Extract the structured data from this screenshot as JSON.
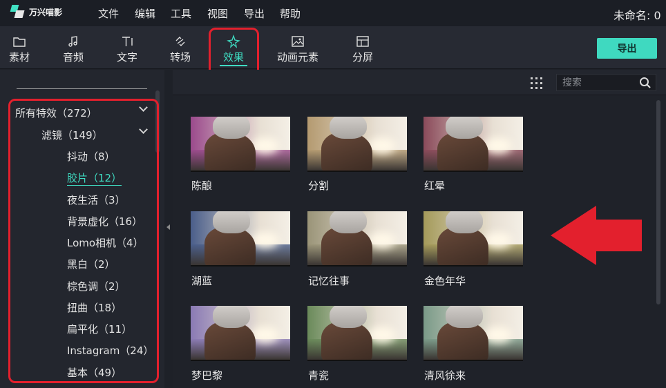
{
  "app": {
    "logo_text": "万兴喵影",
    "title": "未命名: 0"
  },
  "menu": [
    "文件",
    "编辑",
    "工具",
    "视图",
    "导出",
    "帮助"
  ],
  "toolbar": {
    "tabs": [
      {
        "label": "素材",
        "icon": "folder-icon"
      },
      {
        "label": "音频",
        "icon": "music-note-icon"
      },
      {
        "label": "文字",
        "icon": "text-icon"
      },
      {
        "label": "转场",
        "icon": "transition-icon"
      },
      {
        "label": "效果",
        "icon": "effects-icon",
        "active": true
      },
      {
        "label": "动画元素",
        "icon": "image-icon"
      },
      {
        "label": "分屏",
        "icon": "split-screen-icon"
      }
    ],
    "export_label": "导出"
  },
  "sidebar": {
    "all_effects": "所有特效（272）",
    "filters": "滤镜（149）",
    "items": [
      {
        "label": "抖动（8）"
      },
      {
        "label": "胶片（12）",
        "active": true
      },
      {
        "label": "夜生活（3）"
      },
      {
        "label": "背景虚化（16）"
      },
      {
        "label": "Lomo相机（4）"
      },
      {
        "label": "黑白（2）"
      },
      {
        "label": "棕色调（2）"
      },
      {
        "label": "扭曲（18）"
      },
      {
        "label": "扁平化（11）"
      },
      {
        "label": "Instagram（24）"
      },
      {
        "label": "基本（49）"
      }
    ]
  },
  "search": {
    "placeholder": "搜索"
  },
  "effects": [
    {
      "label": "陈酿",
      "tint": "#9b4a8c"
    },
    {
      "label": "分割",
      "tint": "#b49a70"
    },
    {
      "label": "红晕",
      "tint": "#8a4a5a"
    },
    {
      "label": "湖蓝",
      "tint": "#4a5e8a"
    },
    {
      "label": "记忆往事",
      "tint": "#9a9478"
    },
    {
      "label": "金色年华",
      "tint": "#a49a5a"
    },
    {
      "label": "梦巴黎",
      "tint": "#8a7ab4"
    },
    {
      "label": "青瓷",
      "tint": "#6a8a5a"
    },
    {
      "label": "清风徐来",
      "tint": "#7a9a88"
    }
  ],
  "colors": {
    "accent": "#3fdcc2",
    "highlight_red": "#e3202d"
  }
}
